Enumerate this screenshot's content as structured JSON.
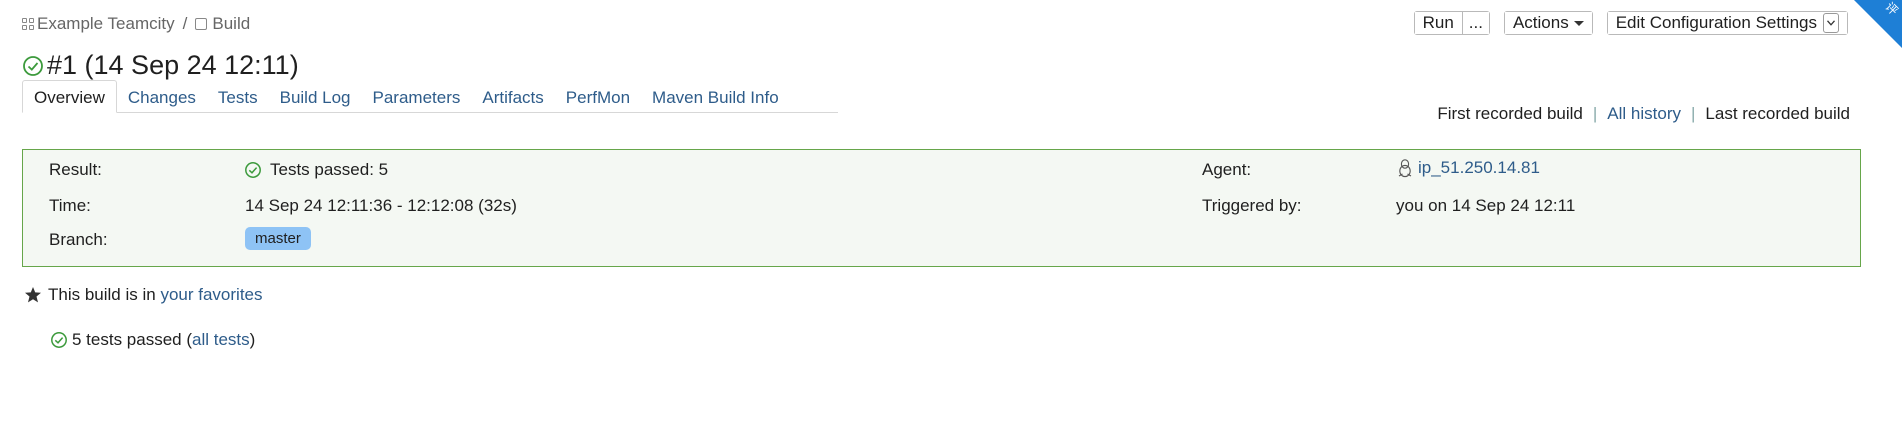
{
  "breadcrumb": {
    "project": "Example Teamcity",
    "separator": "/",
    "build_config": "Build"
  },
  "build": {
    "title": "#1 (14 Sep 24 12:11)",
    "status": "success"
  },
  "toolbar": {
    "run_label": "Run",
    "run_more_label": "...",
    "actions_label": "Actions",
    "edit_config_label": "Edit Configuration Settings"
  },
  "corner_ribbon": {
    "text": "评"
  },
  "tabs": [
    {
      "label": "Overview",
      "active": true
    },
    {
      "label": "Changes",
      "active": false
    },
    {
      "label": "Tests",
      "active": false
    },
    {
      "label": "Build Log",
      "active": false
    },
    {
      "label": "Parameters",
      "active": false
    },
    {
      "label": "Artifacts",
      "active": false
    },
    {
      "label": "PerfMon",
      "active": false
    },
    {
      "label": "Maven Build Info",
      "active": false
    }
  ],
  "history": {
    "first": "First recorded build",
    "all": "All history",
    "last": "Last recorded build",
    "pipe": "|"
  },
  "summary": {
    "result_label": "Result:",
    "result_value": "Tests passed: 5",
    "time_label": "Time:",
    "time_value": "14 Sep 24 12:11:36 - 12:12:08 (32s)",
    "branch_label": "Branch:",
    "branch_value": "master",
    "agent_label": "Agent:",
    "agent_value": "ip_51.250.14.81",
    "triggered_label": "Triggered by:",
    "triggered_value": "you on 14 Sep 24 12:11"
  },
  "favorites": {
    "prefix": "This build is in",
    "link": "your favorites"
  },
  "tests": {
    "text": "5 tests passed (",
    "link": "all tests",
    "suffix": ")"
  },
  "colors": {
    "link": "#2e5c8a",
    "success_green": "#3c9a3c",
    "summary_border": "#66a64a",
    "summary_bg": "#f4f8f3",
    "branch_badge": "#8ec3f5",
    "ribbon": "#1e7fd6"
  },
  "icons": {
    "project": "project-grid-icon",
    "build_config": "build-config-icon",
    "status": "success-check-icon",
    "agent_os": "linux-penguin-icon",
    "favorite": "star-icon"
  }
}
